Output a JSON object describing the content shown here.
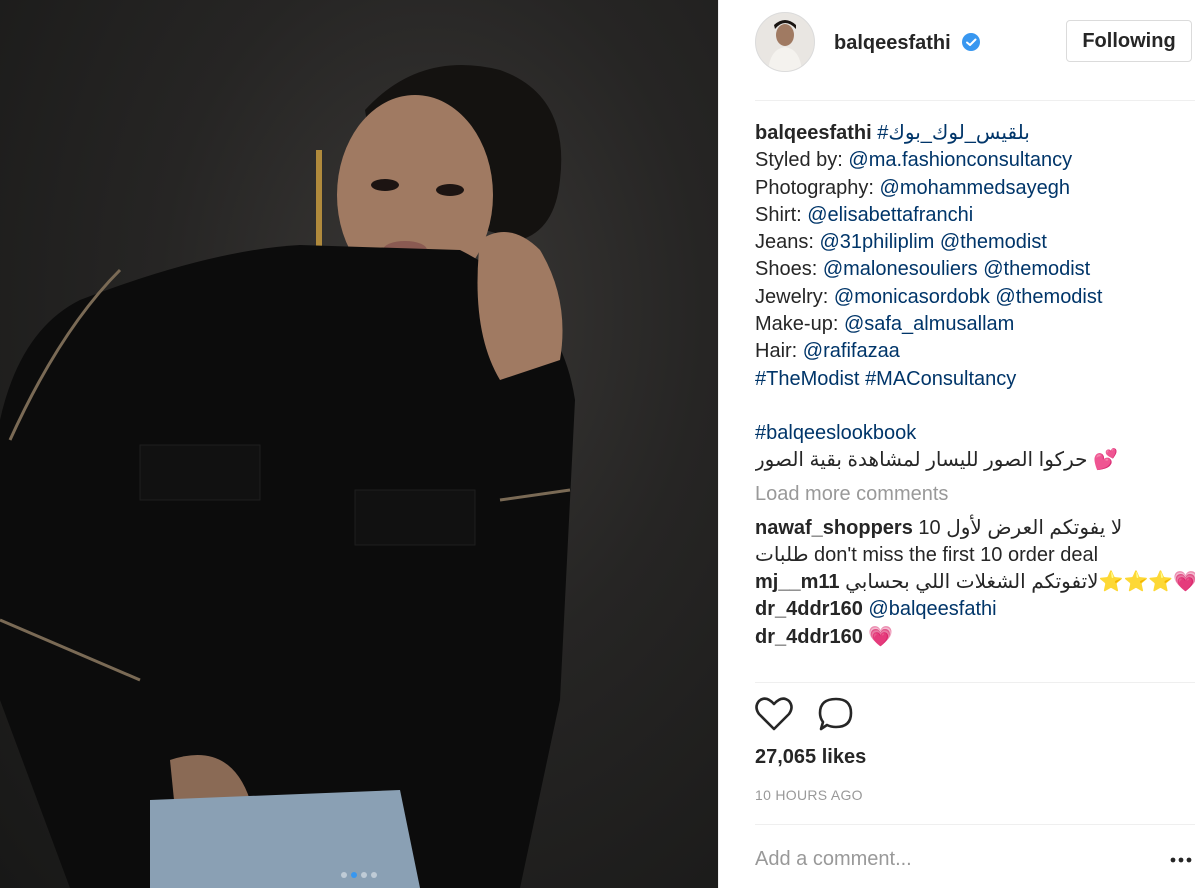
{
  "post": {
    "username": "balqeesfathi",
    "follow_label": "Following",
    "carousel_total": 4,
    "carousel_active": 2
  },
  "caption": {
    "author": "balqeesfathi",
    "hashtag_title": "#بلقيس_لوك_بوك",
    "credits": [
      {
        "label": "Styled by:",
        "handles": [
          "@ma.fashionconsultancy"
        ]
      },
      {
        "label": "Photography:",
        "handles": [
          "@mohammedsayegh"
        ]
      },
      {
        "label": "Shirt:",
        "handles": [
          "@elisabettafranchi"
        ]
      },
      {
        "label": "Jeans:",
        "handles": [
          "@31philiplim",
          "@themodist"
        ]
      },
      {
        "label": "Shoes:",
        "handles": [
          "@malonesouliers",
          "@themodist"
        ]
      },
      {
        "label": "Jewelry:",
        "handles": [
          "@monicasordobk",
          "@themodist"
        ]
      },
      {
        "label": "Make-up:",
        "handles": [
          "@safa_almusallam"
        ]
      },
      {
        "label": "Hair:",
        "handles": [
          "@rafifazaa"
        ]
      }
    ],
    "hashtags_line": [
      "#TheModist",
      "#MAConsultancy"
    ],
    "lookbook_tag": "#balqeeslookbook",
    "arabic_note": "حركوا الصور لليسار لمشاهدة بقية الصور",
    "arabic_note_emoji": "💕"
  },
  "load_more_label": "Load more comments",
  "comments": [
    {
      "user": "nawaf_shoppers",
      "text_line1": "10 لا يفوتكم العرض لأول",
      "text_line2": "طلبات don't miss the first 10 order deal"
    },
    {
      "user": "mj__m11",
      "text": "لاتفوتكم الشغلات اللي بحسابي",
      "emoji": "⭐⭐⭐💗"
    },
    {
      "user": "dr_4ddr160",
      "mention": "@balqeesfathi"
    },
    {
      "user": "dr_4ddr160",
      "emoji": "💗"
    }
  ],
  "likes": "27,065 likes",
  "timestamp": "10 HOURS AGO",
  "add_comment_placeholder": "Add a comment...",
  "icons": {
    "like": "heart-outline-icon",
    "comment": "speech-bubble-icon",
    "verified": "verified-badge-icon",
    "more": "ellipsis-icon"
  },
  "colors": {
    "link": "#003569",
    "verified": "#3897f0",
    "muted": "#999999",
    "text": "#262626"
  }
}
